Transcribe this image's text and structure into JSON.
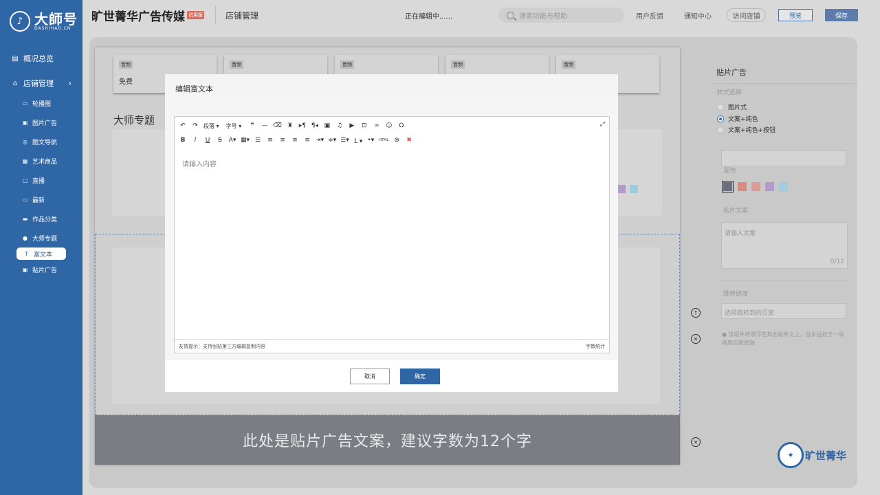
{
  "sidebar": {
    "logo_text": "大師号",
    "logo_sub": "DASHIHAO.CN",
    "items": [
      {
        "label": "概况总览",
        "icon": "dashboard-icon"
      },
      {
        "label": "店铺管理",
        "icon": "home-icon"
      },
      {
        "label": "轮播图",
        "icon": "carousel-icon"
      },
      {
        "label": "图片广告",
        "icon": "image-ad-icon"
      },
      {
        "label": "图文导航",
        "icon": "nav-icon"
      },
      {
        "label": "艺术商品",
        "icon": "goods-icon"
      },
      {
        "label": "直播",
        "icon": "live-icon"
      },
      {
        "label": "最新",
        "icon": "new-icon"
      },
      {
        "label": "作品分类",
        "icon": "category-icon"
      },
      {
        "label": "大师专题",
        "icon": "user-icon"
      },
      {
        "label": "富文本",
        "icon": "rich-text-icon"
      },
      {
        "label": "贴片广告",
        "icon": "sticker-ad-icon"
      }
    ],
    "active_index": 10
  },
  "topbar": {
    "brand": "旷世菁华广告传媒",
    "trial": "试用版",
    "crumb": "店铺管理",
    "status": "正在编辑中......",
    "search_placeholder": "搜索功能与帮助",
    "feedback": "用户反馈",
    "notice": "通知中心",
    "visit": "访问店铺",
    "preview": "预览",
    "save": "保存"
  },
  "preview": {
    "audio_tag": "音频",
    "audio_free": "免费",
    "section_title": "大师专题",
    "banner_text": "此处是贴片广告文案，建议字数为12个字"
  },
  "right_panel": {
    "title": "贴片广告",
    "style_label": "样式选择",
    "options": [
      "图片式",
      "文案+纯色",
      "文案+纯色+按钮"
    ],
    "selected_option": 1,
    "color_label": "配色",
    "swatches": [
      "#6a6f7d",
      "#d98c7e",
      "#e09a96",
      "#b59ad0",
      "#9fcce0"
    ],
    "copy_label": "贴片文案",
    "copy_placeholder": "请输入文案",
    "copy_count": "0/12",
    "link_label": "跳转链接",
    "link_placeholder": "选择跳转到的页面",
    "hint": "该组件将悬浮在其他组件之上，且永远处于一屏高度的最底端"
  },
  "logo_brand": "旷世菁华",
  "modal": {
    "title": "编辑富文本",
    "toolbar_paragraph": "段落",
    "toolbar_fontsize": "字号",
    "placeholder": "请输入内容",
    "footer_hint": "友情提示：支持张贴第三方编辑复制内容",
    "word_count": "字数统计",
    "cancel": "取消",
    "confirm": "确定",
    "html_label": "HTML"
  }
}
